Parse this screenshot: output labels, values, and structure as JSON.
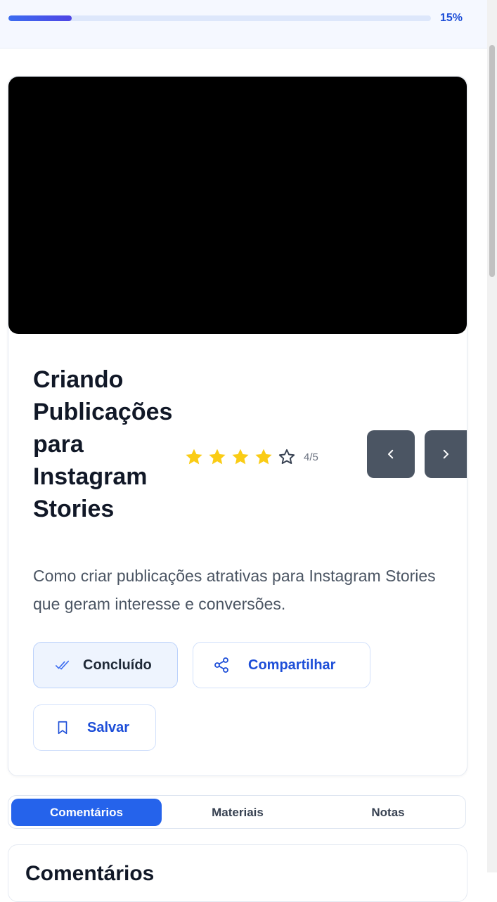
{
  "progress": {
    "percent": 15,
    "label": "15%"
  },
  "lesson": {
    "title": "Criando Publicações para Instagram Stories",
    "description": "Como criar publicações atrativas para Instagram Stories que geram interesse e conversões.",
    "rating": {
      "value": 4,
      "max": 5,
      "label": "4/5"
    }
  },
  "actions": {
    "done_label": "Concluído",
    "share_label": "Compartilhar",
    "save_label": "Salvar"
  },
  "tabs": [
    {
      "label": "Comentários",
      "active": true
    },
    {
      "label": "Materiais",
      "active": false
    },
    {
      "label": "Notas",
      "active": false
    }
  ],
  "comments": {
    "heading": "Comentários"
  },
  "colors": {
    "accent": "#2563eb",
    "star_filled": "#facc15",
    "nav_button": "#4b5563"
  }
}
